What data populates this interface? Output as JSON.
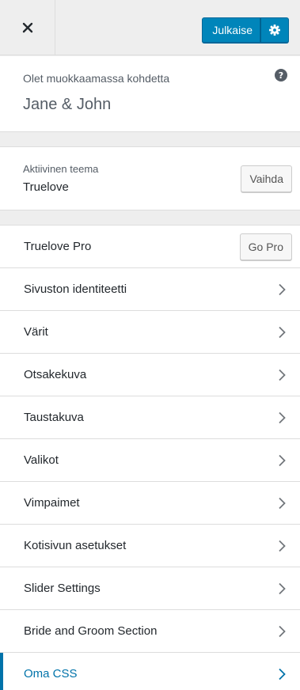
{
  "header": {
    "publish_label": "Julkaise"
  },
  "info": {
    "label": "Olet muokkaamassa kohdetta",
    "site_title": "Jane & John"
  },
  "theme": {
    "label": "Aktiivinen teema",
    "name": "Truelove",
    "change_label": "Vaihda"
  },
  "pro": {
    "label": "Truelove Pro",
    "button_label": "Go Pro"
  },
  "sections": [
    {
      "label": "Sivuston identiteetti"
    },
    {
      "label": "Värit"
    },
    {
      "label": "Otsakekuva"
    },
    {
      "label": "Taustakuva"
    },
    {
      "label": "Valikot"
    },
    {
      "label": "Vimpaimet"
    },
    {
      "label": "Kotisivun asetukset"
    },
    {
      "label": "Slider Settings"
    },
    {
      "label": "Bride and Groom Section"
    },
    {
      "label": "Oma CSS"
    }
  ],
  "icons": {
    "close": "close-icon",
    "gear": "gear-icon",
    "help": "help-icon",
    "chevron": "chevron-right-icon"
  },
  "colors": {
    "accent": "#0085ba",
    "active": "#0073aa",
    "background": "#eeeeee"
  }
}
